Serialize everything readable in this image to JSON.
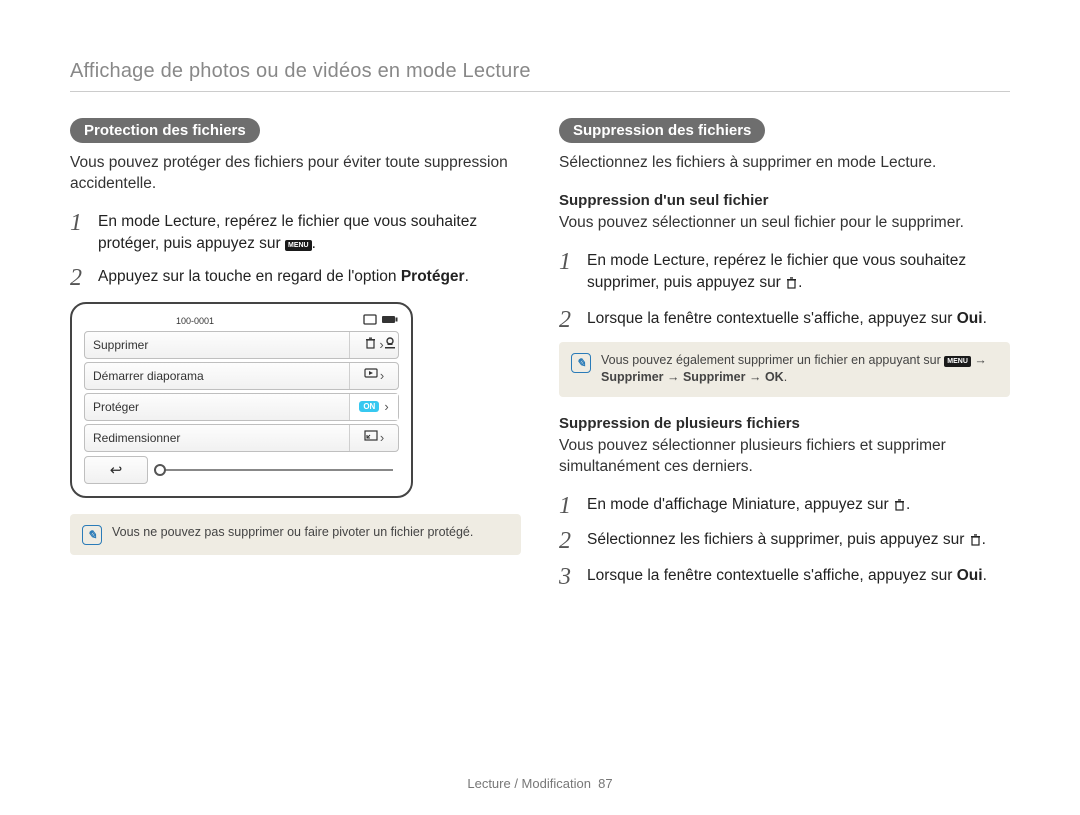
{
  "page": {
    "title": "Affichage de photos ou de vidéos en mode Lecture",
    "footer_section": "Lecture / Modification",
    "footer_page": "87"
  },
  "left": {
    "heading": "Protection des fichiers",
    "intro": "Vous pouvez protéger des fichiers pour éviter toute suppression accidentelle.",
    "steps": {
      "s1a": "En mode Lecture, repérez le fichier que vous souhaitez protéger, puis appuyez sur ",
      "s1b": ".",
      "s2a": "Appuyez sur la touche en regard de l'option ",
      "s2b": "Protéger",
      "s2c": "."
    },
    "screen": {
      "file_number": "100-0001",
      "items": {
        "i0": "Supprimer",
        "i1": "Démarrer diaporama",
        "i2": "Protéger",
        "i3": "Redimensionner",
        "on": "ON"
      }
    },
    "note": "Vous ne pouvez pas supprimer ou faire pivoter un fichier protégé."
  },
  "right": {
    "heading": "Suppression des fichiers",
    "intro": "Sélectionnez les fichiers à supprimer en mode Lecture.",
    "single": {
      "title": "Suppression d'un seul fichier",
      "desc": "Vous pouvez sélectionner un seul fichier pour le supprimer.",
      "s1a": "En mode Lecture, repérez le fichier que vous souhaitez supprimer, puis appuyez sur ",
      "s1b": ".",
      "s2a": "Lorsque la fenêtre contextuelle s'affiche, appuyez sur ",
      "s2b": "Oui",
      "s2c": "."
    },
    "tip": {
      "line1": "Vous pouvez également supprimer un fichier en appuyant sur ",
      "arrow": " → ",
      "bold1": "Supprimer",
      "bold2": "Supprimer",
      "ok": "OK",
      "tail": "."
    },
    "multi": {
      "title": "Suppression de plusieurs fichiers",
      "desc": "Vous pouvez sélectionner plusieurs fichiers et supprimer simultanément ces derniers.",
      "s1a": "En mode d'affichage Miniature, appuyez sur ",
      "s1b": ".",
      "s2a": "Sélectionnez les fichiers à supprimer, puis appuyez sur ",
      "s2b": ".",
      "s3a": "Lorsque la fenêtre contextuelle s'affiche, appuyez sur ",
      "s3b": "Oui",
      "s3c": "."
    }
  },
  "icons": {
    "menu": "MENU"
  }
}
